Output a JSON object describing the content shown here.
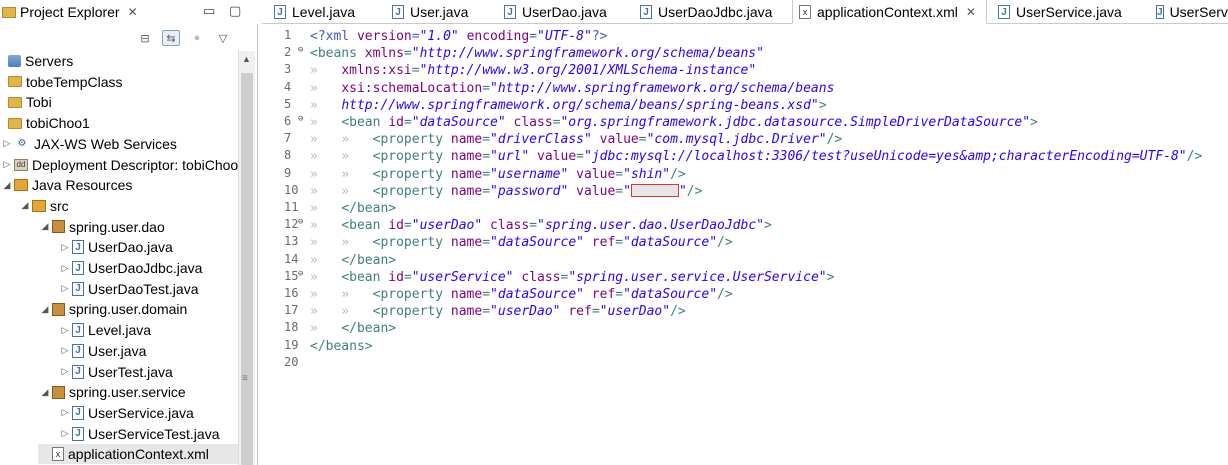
{
  "explorer": {
    "title": "Project Explorer",
    "close_glyph": "✕",
    "minimize_glyph": "▭",
    "maximize_glyph": "▢",
    "toolbar": {
      "collapse_all": "⊟",
      "link_with_editor": "⇆",
      "focus": "●",
      "view_menu": "▽"
    },
    "tree": [
      {
        "label": "Servers",
        "icon": "server-icon",
        "indent": 0,
        "twisty": ""
      },
      {
        "label": "tobeTempClass",
        "icon": "project-icon",
        "indent": 0,
        "twisty": ""
      },
      {
        "label": "Tobi",
        "icon": "project-icon",
        "indent": 0,
        "twisty": ""
      },
      {
        "label": "tobiChoo1",
        "icon": "project-icon",
        "indent": 0,
        "twisty": ""
      },
      {
        "label": "JAX-WS Web Services",
        "icon": "web-services-icon",
        "indent": 1,
        "twisty": "▷"
      },
      {
        "label": "Deployment Descriptor: tobiChoo",
        "icon": "deployment-descriptor-icon",
        "indent": 1,
        "twisty": "▷"
      },
      {
        "label": "Java Resources",
        "icon": "java-resources-icon",
        "indent": 1,
        "twisty": "◢"
      },
      {
        "label": "src",
        "icon": "source-folder-icon",
        "indent": 2,
        "twisty": "◢"
      },
      {
        "label": "spring.user.dao",
        "icon": "package-icon",
        "indent": 3,
        "twisty": "◢"
      },
      {
        "label": "UserDao.java",
        "icon": "java-file-icon",
        "indent": 4,
        "twisty": "▷"
      },
      {
        "label": "UserDaoJdbc.java",
        "icon": "java-file-icon",
        "indent": 4,
        "twisty": "▷"
      },
      {
        "label": "UserDaoTest.java",
        "icon": "java-file-icon",
        "indent": 4,
        "twisty": "▷"
      },
      {
        "label": "spring.user.domain",
        "icon": "package-icon",
        "indent": 3,
        "twisty": "◢"
      },
      {
        "label": "Level.java",
        "icon": "java-file-icon",
        "indent": 4,
        "twisty": "▷"
      },
      {
        "label": "User.java",
        "icon": "java-file-icon",
        "indent": 4,
        "twisty": "▷"
      },
      {
        "label": "UserTest.java",
        "icon": "java-file-icon",
        "indent": 4,
        "twisty": "▷"
      },
      {
        "label": "spring.user.service",
        "icon": "package-icon",
        "indent": 3,
        "twisty": "◢"
      },
      {
        "label": "UserService.java",
        "icon": "java-file-icon",
        "indent": 4,
        "twisty": "▷"
      },
      {
        "label": "UserServiceTest.java",
        "icon": "java-file-icon",
        "indent": 4,
        "twisty": "▷"
      },
      {
        "label": "applicationContext.xml",
        "icon": "xml-file-icon",
        "indent": 3,
        "twisty": "",
        "selected": true
      }
    ]
  },
  "editor": {
    "tabs": [
      {
        "label": "Level.java",
        "icon": "java-file-icon",
        "active": false
      },
      {
        "label": "User.java",
        "icon": "java-file-icon",
        "active": false
      },
      {
        "label": "UserDao.java",
        "icon": "java-file-icon",
        "active": false
      },
      {
        "label": "UserDaoJdbc.java",
        "icon": "java-file-icon",
        "active": false
      },
      {
        "label": "applicationContext.xml",
        "icon": "xml-file-icon",
        "active": true
      },
      {
        "label": "UserService.java",
        "icon": "java-file-icon",
        "active": false
      },
      {
        "label": "UserServi",
        "icon": "java-file-icon",
        "active": false
      }
    ],
    "lines": [
      {
        "n": "1",
        "fold": "",
        "segs": [
          [
            "pi",
            "<?xml "
          ],
          [
            "attr",
            "version"
          ],
          [
            "pi",
            "="
          ],
          [
            "val",
            "\"1.0\""
          ],
          [
            "pi",
            " "
          ],
          [
            "attr",
            "encoding"
          ],
          [
            "pi",
            "="
          ],
          [
            "val",
            "\"UTF-8\""
          ],
          [
            "pi",
            "?>"
          ]
        ]
      },
      {
        "n": "2",
        "fold": "⊖",
        "segs": [
          [
            "tag",
            "<beans "
          ],
          [
            "attr",
            "xmlns"
          ],
          [
            "tag",
            "="
          ],
          [
            "val",
            "\"http://www.springframework.org/schema/beans\""
          ]
        ]
      },
      {
        "n": "3",
        "fold": "",
        "segs": [
          [
            "ws",
            "»   "
          ],
          [
            "attr",
            "xmlns:xsi"
          ],
          [
            "tag",
            "="
          ],
          [
            "val",
            "\"http://www.w3.org/2001/XMLSchema-instance\""
          ]
        ]
      },
      {
        "n": "4",
        "fold": "",
        "segs": [
          [
            "ws",
            "»   "
          ],
          [
            "attr",
            "xsi:schemaLocation"
          ],
          [
            "tag",
            "="
          ],
          [
            "val",
            "\"http://www.springframework.org/schema/beans"
          ]
        ]
      },
      {
        "n": "5",
        "fold": "",
        "segs": [
          [
            "ws",
            "»   "
          ],
          [
            "val",
            "http://www.springframework.org/schema/beans/spring-beans.xsd\""
          ],
          [
            "tag",
            ">"
          ]
        ]
      },
      {
        "n": "6",
        "fold": "⊖",
        "segs": [
          [
            "ws",
            "»   "
          ],
          [
            "tag",
            "<bean "
          ],
          [
            "attr",
            "id"
          ],
          [
            "tag",
            "="
          ],
          [
            "val",
            "\"dataSource\""
          ],
          [
            "tag",
            " "
          ],
          [
            "attr",
            "class"
          ],
          [
            "tag",
            "="
          ],
          [
            "val",
            "\"org.springframework.jdbc.datasource.SimpleDriverDataSource\""
          ],
          [
            "tag",
            ">"
          ]
        ]
      },
      {
        "n": "7",
        "fold": "",
        "segs": [
          [
            "ws",
            "»   »   "
          ],
          [
            "tag",
            "<property "
          ],
          [
            "attr",
            "name"
          ],
          [
            "tag",
            "="
          ],
          [
            "val",
            "\"driverClass\""
          ],
          [
            "tag",
            " "
          ],
          [
            "attr",
            "value"
          ],
          [
            "tag",
            "="
          ],
          [
            "val",
            "\"com.mysql.jdbc.Driver\""
          ],
          [
            "tag",
            "/>"
          ]
        ]
      },
      {
        "n": "8",
        "fold": "",
        "segs": [
          [
            "ws",
            "»   »   "
          ],
          [
            "tag",
            "<property "
          ],
          [
            "attr",
            "name"
          ],
          [
            "tag",
            "="
          ],
          [
            "val",
            "\"url\""
          ],
          [
            "tag",
            " "
          ],
          [
            "attr",
            "value"
          ],
          [
            "tag",
            "="
          ],
          [
            "val",
            "\"jdbc:mysql://localhost:3306/test?useUnicode=yes&amp;characterEncoding=UTF-8\""
          ],
          [
            "tag",
            "/>"
          ]
        ]
      },
      {
        "n": "9",
        "fold": "",
        "segs": [
          [
            "ws",
            "»   »   "
          ],
          [
            "tag",
            "<property "
          ],
          [
            "attr",
            "name"
          ],
          [
            "tag",
            "="
          ],
          [
            "val",
            "\"username\""
          ],
          [
            "tag",
            " "
          ],
          [
            "attr",
            "value"
          ],
          [
            "tag",
            "="
          ],
          [
            "val",
            "\"shin\""
          ],
          [
            "tag",
            "/>"
          ]
        ]
      },
      {
        "n": "10",
        "fold": "",
        "segs": [
          [
            "ws",
            "»   »   "
          ],
          [
            "tag",
            "<property "
          ],
          [
            "attr",
            "name"
          ],
          [
            "tag",
            "="
          ],
          [
            "val",
            "\"password\""
          ],
          [
            "tag",
            " "
          ],
          [
            "attr",
            "value"
          ],
          [
            "tag",
            "="
          ],
          [
            "val",
            "\""
          ],
          [
            "redact",
            ""
          ],
          [
            "val",
            "\""
          ],
          [
            "tag",
            "/>"
          ]
        ]
      },
      {
        "n": "11",
        "fold": "",
        "segs": [
          [
            "ws",
            "»   "
          ],
          [
            "tag",
            "</bean>"
          ]
        ]
      },
      {
        "n": "12",
        "fold": "⊖",
        "segs": [
          [
            "ws",
            "»   "
          ],
          [
            "tag",
            "<bean "
          ],
          [
            "attr",
            "id"
          ],
          [
            "tag",
            "="
          ],
          [
            "val",
            "\"userDao\""
          ],
          [
            "tag",
            " "
          ],
          [
            "attr",
            "class"
          ],
          [
            "tag",
            "="
          ],
          [
            "val",
            "\"spring.user.dao.UserDaoJdbc\""
          ],
          [
            "tag",
            ">"
          ]
        ]
      },
      {
        "n": "13",
        "fold": "",
        "segs": [
          [
            "ws",
            "»   »   "
          ],
          [
            "tag",
            "<property "
          ],
          [
            "attr",
            "name"
          ],
          [
            "tag",
            "="
          ],
          [
            "val",
            "\"dataSource\""
          ],
          [
            "tag",
            " "
          ],
          [
            "attr",
            "ref"
          ],
          [
            "tag",
            "="
          ],
          [
            "val",
            "\"dataSource\""
          ],
          [
            "tag",
            "/>"
          ]
        ]
      },
      {
        "n": "14",
        "fold": "",
        "segs": [
          [
            "ws",
            "»   "
          ],
          [
            "tag",
            "</bean>"
          ]
        ]
      },
      {
        "n": "15",
        "fold": "⊖",
        "segs": [
          [
            "ws",
            "»   "
          ],
          [
            "tag",
            "<bean "
          ],
          [
            "attr",
            "id"
          ],
          [
            "tag",
            "="
          ],
          [
            "val",
            "\"userService\""
          ],
          [
            "tag",
            " "
          ],
          [
            "attr",
            "class"
          ],
          [
            "tag",
            "="
          ],
          [
            "val",
            "\"spring.user.service.UserService\""
          ],
          [
            "tag",
            ">"
          ]
        ]
      },
      {
        "n": "16",
        "fold": "",
        "segs": [
          [
            "ws",
            "»   »   "
          ],
          [
            "tag",
            "<property "
          ],
          [
            "attr",
            "name"
          ],
          [
            "tag",
            "="
          ],
          [
            "val",
            "\"dataSource\""
          ],
          [
            "tag",
            " "
          ],
          [
            "attr",
            "ref"
          ],
          [
            "tag",
            "="
          ],
          [
            "val",
            "\"dataSource\""
          ],
          [
            "tag",
            "/>"
          ]
        ]
      },
      {
        "n": "17",
        "fold": "",
        "segs": [
          [
            "ws",
            "»   »   "
          ],
          [
            "tag",
            "<property "
          ],
          [
            "attr",
            "name"
          ],
          [
            "tag",
            "="
          ],
          [
            "val",
            "\"userDao\""
          ],
          [
            "tag",
            " "
          ],
          [
            "attr",
            "ref"
          ],
          [
            "tag",
            "="
          ],
          [
            "val",
            "\"userDao\""
          ],
          [
            "tag",
            "/>"
          ]
        ]
      },
      {
        "n": "18",
        "fold": "",
        "segs": [
          [
            "ws",
            "»   "
          ],
          [
            "tag",
            "</bean>"
          ]
        ]
      },
      {
        "n": "19",
        "fold": "",
        "segs": [
          [
            "tag",
            "</beans>"
          ]
        ]
      },
      {
        "n": "20",
        "fold": "",
        "segs": []
      }
    ]
  },
  "colors": {
    "tag": "#3f7f7f",
    "attribute": "#7f007f",
    "value": "#2a00ff",
    "redaction_border": "#e23232"
  }
}
